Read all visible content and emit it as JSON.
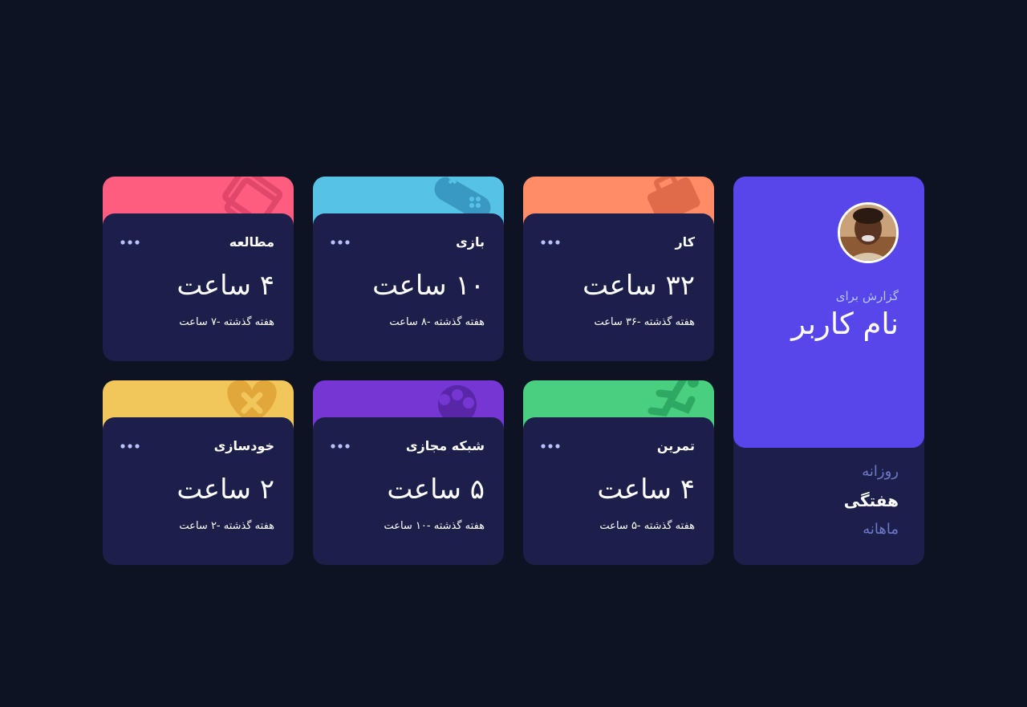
{
  "profile": {
    "report_for": "گزارش برای",
    "name": "نام کاربر",
    "periods": [
      "روزانه",
      "هفتگی",
      "ماهانه"
    ],
    "active_period": "هفتگی"
  },
  "cards": [
    {
      "title": "کار",
      "current": "۳۲ ساعت",
      "previous": "هفته گذشته -۳۶ ساعت",
      "color": "#ff8c66",
      "icon": "briefcase-icon"
    },
    {
      "title": "بازی",
      "current": "۱۰ ساعت",
      "previous": "هفته گذشته -۸ ساعت",
      "color": "#56c2e6",
      "icon": "gamepad-icon"
    },
    {
      "title": "مطالعه",
      "current": "۴ ساعت",
      "previous": "هفته گذشته -۷ ساعت",
      "color": "#ff5d7f",
      "icon": "books-icon"
    },
    {
      "title": "تمرین",
      "current": "۴ ساعت",
      "previous": "هفته گذشته -۵ ساعت",
      "color": "#4acf81",
      "icon": "running-icon"
    },
    {
      "title": "شبکه مجازی",
      "current": "۵ ساعت",
      "previous": "هفته گذشته -۱۰ ساعت",
      "color": "#7536d3",
      "icon": "social-icon"
    },
    {
      "title": "خودسازی",
      "current": "۲ ساعت",
      "previous": "هفته گذشته -۲ ساعت",
      "color": "#f1c65b",
      "icon": "heart-icon"
    }
  ],
  "colors": {
    "background": "#0e1323",
    "card": "#1c1f4a",
    "accent": "#5747ea",
    "muted": "#7078c9",
    "dots": "#bbc0ff"
  }
}
